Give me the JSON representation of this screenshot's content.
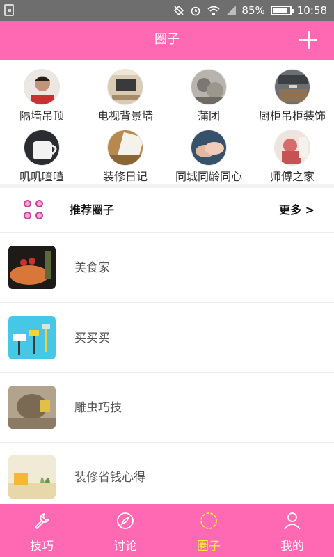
{
  "status_bar": {
    "battery": "85%",
    "time": "10:58"
  },
  "header": {
    "title": "圈子"
  },
  "categories": [
    {
      "label": "隔墙吊顶"
    },
    {
      "label": "电视背景墙"
    },
    {
      "label": "蒲团"
    },
    {
      "label": "厨柜吊柜装饰"
    },
    {
      "label": "叽叽喳喳"
    },
    {
      "label": "装修日记"
    },
    {
      "label": "同城同龄同心"
    },
    {
      "label": "师傅之家"
    }
  ],
  "recommended": {
    "title": "推荐圈子",
    "more": "更多 >"
  },
  "circles": [
    {
      "name": "美食家"
    },
    {
      "name": "买买买"
    },
    {
      "name": "雕虫巧技"
    },
    {
      "name": "装修省钱心得"
    }
  ],
  "tabs": [
    {
      "label": "技巧",
      "icon": "wrench-icon"
    },
    {
      "label": "讨论",
      "icon": "compass-icon"
    },
    {
      "label": "圈子",
      "icon": "circle-icon"
    },
    {
      "label": "我的",
      "icon": "user-icon"
    }
  ],
  "colors": {
    "brand": "#ff69b4",
    "active_tab": "#ffeb3b",
    "statusbar": "#6e6e6e"
  }
}
